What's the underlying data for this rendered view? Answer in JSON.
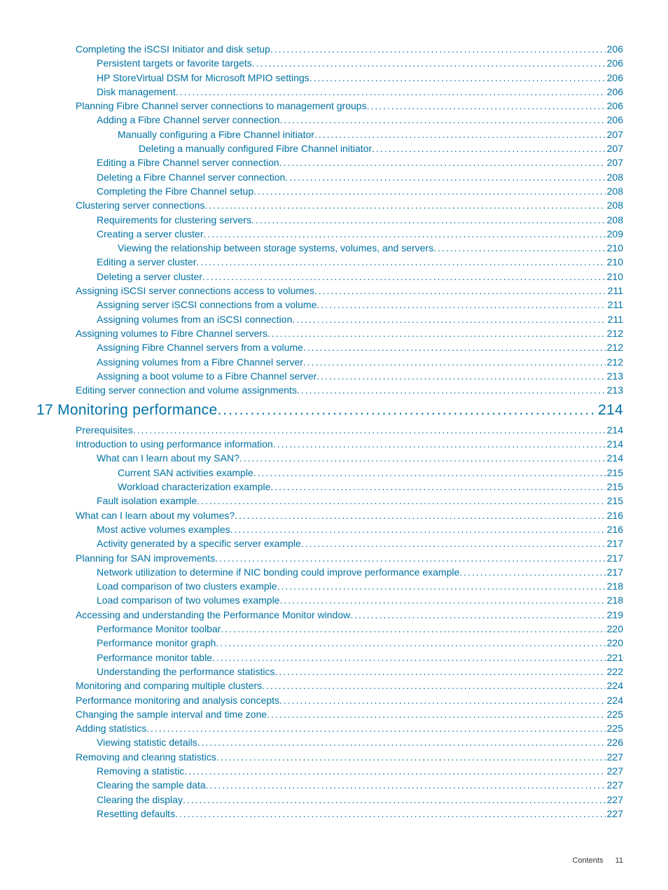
{
  "entries": [
    {
      "title": "Completing the iSCSI Initiator and disk setup",
      "page": "206",
      "level": 1
    },
    {
      "title": "Persistent targets or favorite targets",
      "page": "206",
      "level": 2
    },
    {
      "title": "HP StoreVirtual DSM for Microsoft MPIO settings",
      "page": "206",
      "level": 2
    },
    {
      "title": "Disk management",
      "page": "206",
      "level": 2
    },
    {
      "title": "Planning Fibre Channel server connections to management groups",
      "page": "206",
      "level": 1
    },
    {
      "title": "Adding a Fibre Channel server connection",
      "page": "206",
      "level": 2
    },
    {
      "title": "Manually configuring a Fibre Channel initiator",
      "page": "207",
      "level": 3
    },
    {
      "title": "Deleting a manually configured Fibre Channel initiator",
      "page": "207",
      "level": 4
    },
    {
      "title": "Editing a Fibre Channel server connection",
      "page": "207",
      "level": 2
    },
    {
      "title": "Deleting a Fibre Channel server connection",
      "page": "208",
      "level": 2
    },
    {
      "title": "Completing the Fibre Channel setup",
      "page": "208",
      "level": 2
    },
    {
      "title": "Clustering server connections",
      "page": "208",
      "level": 1
    },
    {
      "title": "Requirements for clustering servers",
      "page": "208",
      "level": 2
    },
    {
      "title": "Creating a server cluster",
      "page": "209",
      "level": 2
    },
    {
      "title": "Viewing the relationship between storage systems, volumes, and servers",
      "page": "210",
      "level": 3
    },
    {
      "title": "Editing a server cluster",
      "page": "210",
      "level": 2
    },
    {
      "title": "Deleting a server cluster",
      "page": "210",
      "level": 2
    },
    {
      "title": "Assigning iSCSI server connections access to volumes",
      "page": "211",
      "level": 1
    },
    {
      "title": "Assigning server iSCSI connections from a volume",
      "page": "211",
      "level": 2
    },
    {
      "title": "Assigning volumes from an iSCSI connection",
      "page": "211",
      "level": 2
    },
    {
      "title": "Assigning volumes to Fibre Channel servers",
      "page": "212",
      "level": 1
    },
    {
      "title": "Assigning Fibre Channel servers from a volume",
      "page": "212",
      "level": 2
    },
    {
      "title": "Assigning volumes from a Fibre Channel server",
      "page": "212",
      "level": 2
    },
    {
      "title": "Assigning a boot volume to a Fibre Channel server",
      "page": "213",
      "level": 2
    },
    {
      "title": "Editing server connection and volume assignments",
      "page": "213",
      "level": 1
    },
    {
      "title": "17 Monitoring performance",
      "page": "214",
      "level": 0,
      "chapter": true
    },
    {
      "title": "Prerequisites",
      "page": "214",
      "level": 1
    },
    {
      "title": "Introduction to using performance information",
      "page": "214",
      "level": 1
    },
    {
      "title": "What can I learn about my SAN?",
      "page": "214",
      "level": 2
    },
    {
      "title": "Current SAN activities example",
      "page": "215",
      "level": 3
    },
    {
      "title": "Workload characterization example",
      "page": "215",
      "level": 3
    },
    {
      "title": "Fault isolation example",
      "page": "215",
      "level": 2
    },
    {
      "title": "What can I learn about my volumes?",
      "page": "216",
      "level": 1
    },
    {
      "title": "Most active volumes examples",
      "page": "216",
      "level": 2
    },
    {
      "title": "Activity generated by a specific server example",
      "page": "217",
      "level": 2
    },
    {
      "title": "Planning for SAN improvements",
      "page": "217",
      "level": 1
    },
    {
      "title": "Network utilization to determine if NIC bonding could improve performance example",
      "page": "217",
      "level": 2
    },
    {
      "title": "Load comparison of two clusters example",
      "page": "218",
      "level": 2
    },
    {
      "title": "Load comparison of two volumes example",
      "page": "218",
      "level": 2
    },
    {
      "title": "Accessing and understanding the Performance Monitor window",
      "page": "219",
      "level": 1
    },
    {
      "title": "Performance Monitor toolbar",
      "page": "220",
      "level": 2
    },
    {
      "title": "Performance monitor graph",
      "page": "220",
      "level": 2
    },
    {
      "title": "Performance monitor table",
      "page": "221",
      "level": 2
    },
    {
      "title": "Understanding the performance statistics",
      "page": "222",
      "level": 2
    },
    {
      "title": "Monitoring and comparing multiple clusters",
      "page": "224",
      "level": 1
    },
    {
      "title": "Performance monitoring and analysis concepts",
      "page": "224",
      "level": 1
    },
    {
      "title": "Changing the sample interval and time zone",
      "page": "225",
      "level": 1
    },
    {
      "title": "Adding statistics",
      "page": "225",
      "level": 1
    },
    {
      "title": "Viewing statistic details",
      "page": "226",
      "level": 2
    },
    {
      "title": "Removing and clearing statistics",
      "page": "227",
      "level": 1
    },
    {
      "title": "Removing a statistic",
      "page": "227",
      "level": 2
    },
    {
      "title": "Clearing the sample data",
      "page": "227",
      "level": 2
    },
    {
      "title": "Clearing the display",
      "page": "227",
      "level": 2
    },
    {
      "title": "Resetting defaults",
      "page": "227",
      "level": 2
    }
  ],
  "footer": {
    "label": "Contents",
    "page": "11"
  }
}
